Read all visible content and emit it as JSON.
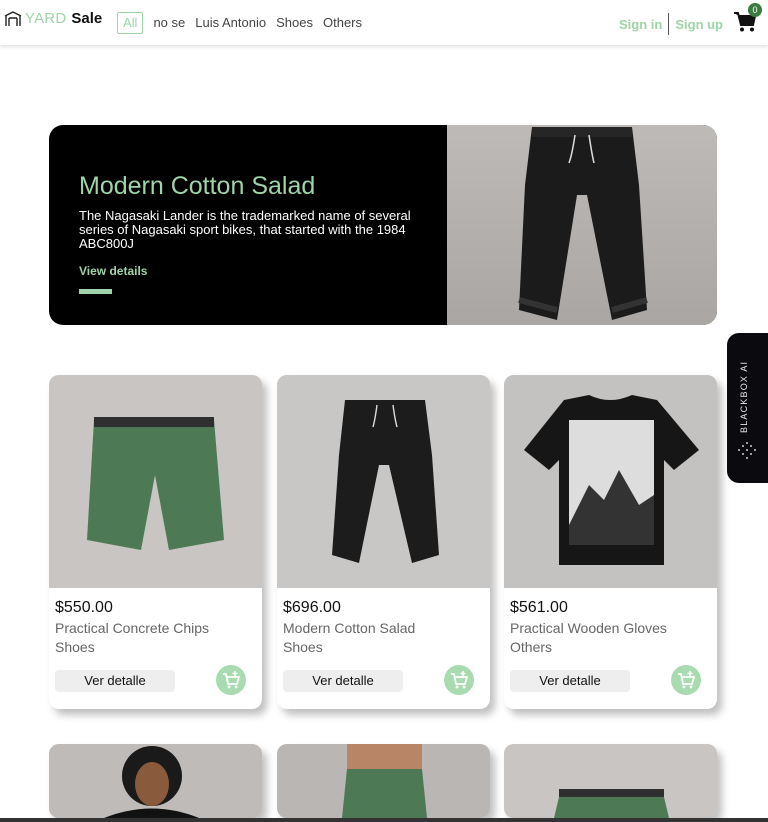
{
  "header": {
    "logo": {
      "part1": "YARD",
      "part2": "Sale"
    },
    "nav": [
      {
        "label": "All",
        "active": true
      },
      {
        "label": "no se"
      },
      {
        "label": "Luis Antonio"
      },
      {
        "label": "Shoes"
      },
      {
        "label": "Others"
      }
    ],
    "sign_in": "Sign in",
    "sign_up": "Sign up",
    "cart_count": "0"
  },
  "hero": {
    "title": "Modern Cotton Salad",
    "description": "The Nagasaki Lander is the trademarked name of several series of Nagasaki sport bikes, that started with the 1984 ABC800J",
    "link": "View details",
    "image": "black-jogger-pants"
  },
  "products": [
    {
      "price": "$550.00",
      "name": "Practical Concrete Chips",
      "category": "Shoes",
      "button": "Ver detalle",
      "image": "green-shorts"
    },
    {
      "price": "$696.00",
      "name": "Modern Cotton Salad",
      "category": "Shoes",
      "button": "Ver detalle",
      "image": "black-jogger-pants"
    },
    {
      "price": "$561.00",
      "name": "Practical Wooden Gloves",
      "category": "Others",
      "button": "Ver detalle",
      "image": "black-mountain-tshirt"
    }
  ],
  "next_row": [
    {
      "image": "woman-portrait"
    },
    {
      "image": "green-pants-model"
    },
    {
      "image": "green-shorts"
    }
  ],
  "side_tab": {
    "label": "BLACKBOX AI"
  },
  "colors": {
    "accent": "#9fd3a8",
    "badge": "#3a7b3f",
    "hero_bg": "#000000"
  }
}
